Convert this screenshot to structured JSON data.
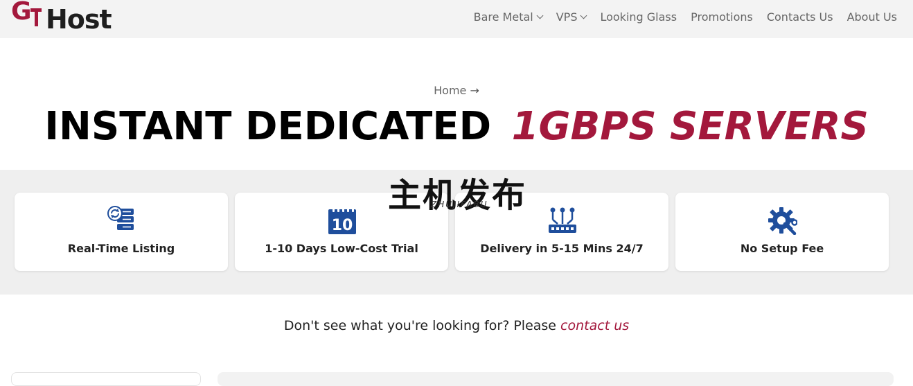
{
  "header": {
    "logo_text": "Host",
    "nav": [
      {
        "label": "Bare Metal",
        "has_dropdown": true
      },
      {
        "label": "VPS",
        "has_dropdown": true
      },
      {
        "label": "Looking Glass",
        "has_dropdown": false
      },
      {
        "label": "Promotions",
        "has_dropdown": false
      },
      {
        "label": "Contacts Us",
        "has_dropdown": false
      },
      {
        "label": "About Us",
        "has_dropdown": false
      }
    ]
  },
  "breadcrumb": {
    "home": "Home",
    "arrow": "→"
  },
  "hero": {
    "title_main": "INSTANT DEDICATED",
    "title_accent": "1GBPS SERVERS"
  },
  "features": [
    {
      "label": "Real-Time Listing",
      "icon": "server-refresh-icon"
    },
    {
      "label": "1-10 Days Low-Cost Trial",
      "icon": "calendar-10-icon"
    },
    {
      "label": "Delivery in 5-15 Mins 24/7",
      "icon": "network-switch-icon"
    },
    {
      "label": "No Setup Fee",
      "icon": "gear-wrench-icon"
    }
  ],
  "watermark": {
    "chinese": "主机发布",
    "pinyin": "ZHUJIFABU"
  },
  "cta": {
    "text": "Don't see what you're looking for? Please",
    "link": "contact us"
  },
  "colors": {
    "brand": "#a3183c",
    "icon_blue": "#1f4e9c",
    "band_bg": "#efefef"
  }
}
